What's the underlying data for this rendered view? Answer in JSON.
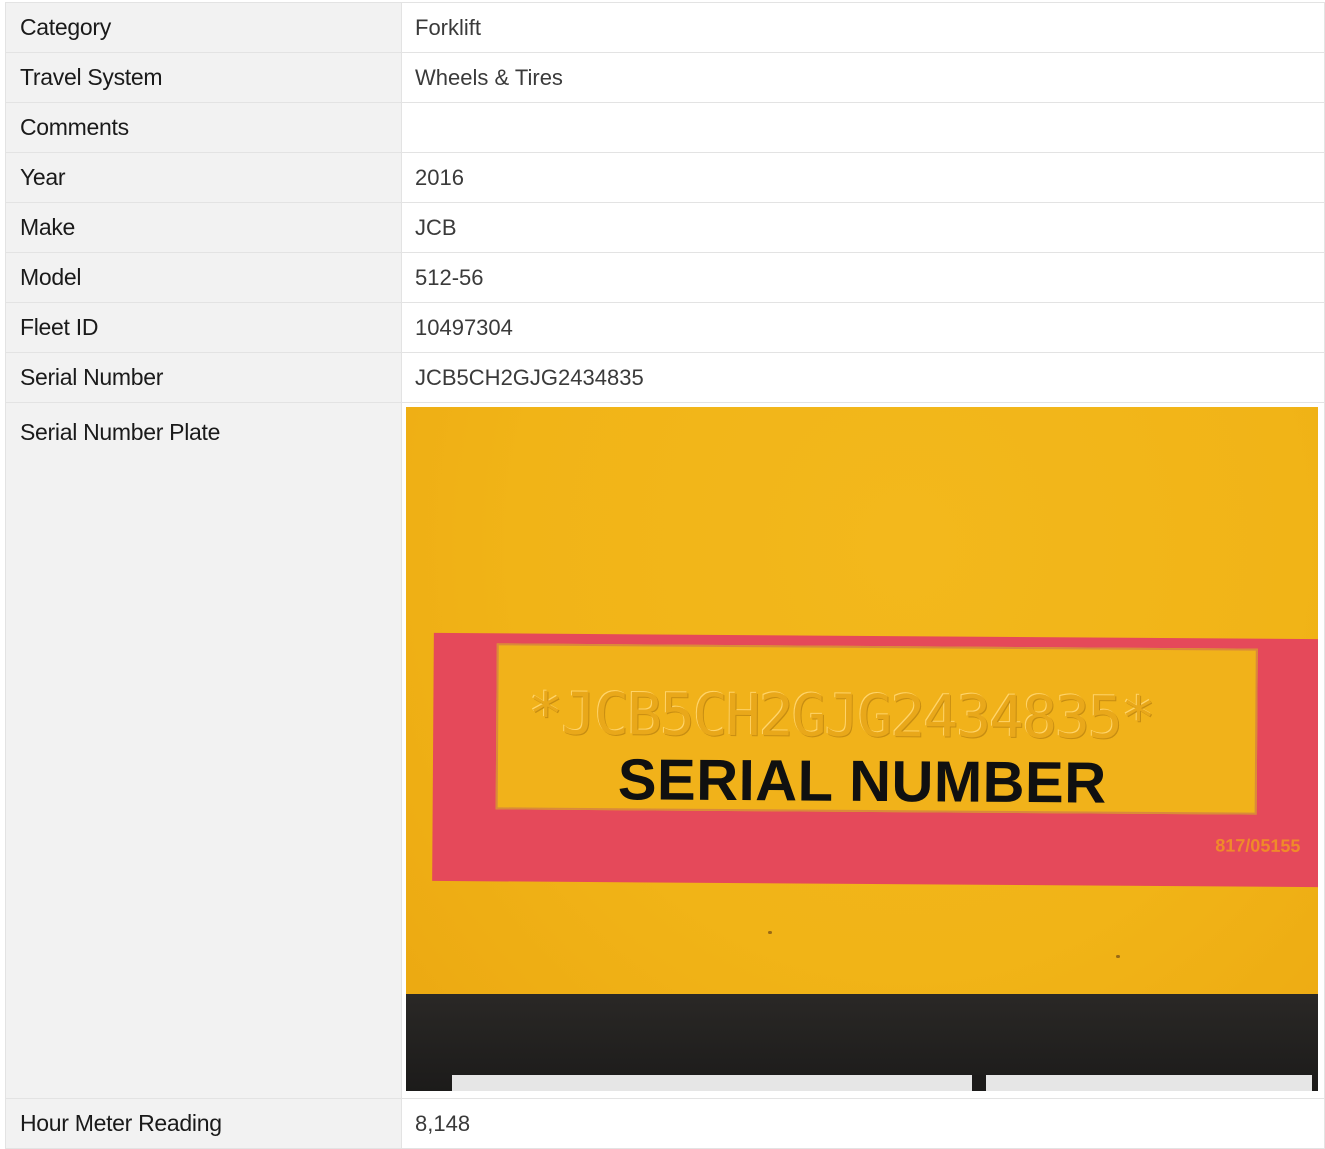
{
  "rows": [
    {
      "label": "Category",
      "value": "Forklift"
    },
    {
      "label": "Travel System",
      "value": "Wheels & Tires"
    },
    {
      "label": "Comments",
      "value": ""
    },
    {
      "label": "Year",
      "value": "2016"
    },
    {
      "label": "Make",
      "value": "JCB"
    },
    {
      "label": "Model",
      "value": "512-56"
    },
    {
      "label": "Fleet ID",
      "value": "10497304"
    },
    {
      "label": "Serial Number",
      "value": "JCB5CH2GJG2434835"
    }
  ],
  "serial_plate": {
    "label": "Serial Number Plate",
    "stamped_text": "*JCB5CH2GJG2434835*",
    "plate_heading": "SERIAL NUMBER",
    "plate_code": "817/05155"
  },
  "hour_meter": {
    "label": "Hour Meter Reading",
    "value": "8,148"
  },
  "colors": {
    "label_bg": "#f2f2f2",
    "border": "#e3e3e3",
    "plate_yellow": "#f1b417",
    "plate_red": "#e5495a"
  }
}
